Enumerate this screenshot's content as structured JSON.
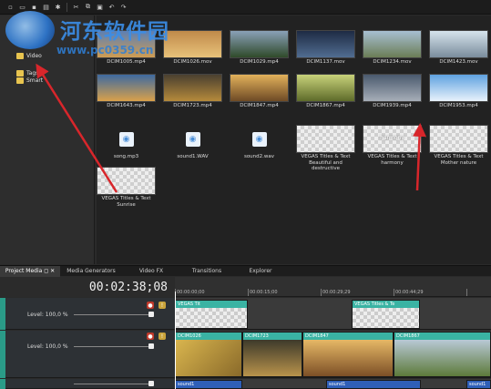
{
  "watermark": {
    "title": "河东软件园",
    "url": "www.pc0359.cn"
  },
  "tree": {
    "items": [
      "Video",
      "Tags",
      "Smart"
    ]
  },
  "media": [
    {
      "label": "DCIM1005.mp4",
      "type": "video",
      "c1": "#5b7fb5",
      "c2": "#cf9c52"
    },
    {
      "label": "DCIM1026.mov",
      "type": "video",
      "c1": "#c08a4a",
      "c2": "#e8c27a"
    },
    {
      "label": "DCIM1029.mp4",
      "type": "video",
      "c1": "#8aa0b8",
      "c2": "#2f4a2a"
    },
    {
      "label": "DCIM1137.mov",
      "type": "video",
      "c1": "#1e2b44",
      "c2": "#516d91"
    },
    {
      "label": "DCIM1234.mov",
      "type": "video",
      "c1": "#a7bfd2",
      "c2": "#6b7d56"
    },
    {
      "label": "DCIM1423.mov",
      "type": "video",
      "c1": "#d6e3ec",
      "c2": "#7a8c9c"
    },
    {
      "label": "DCIM1643.mp4",
      "type": "video",
      "c1": "#3e6aa0",
      "c2": "#d9a14a"
    },
    {
      "label": "DCIM1723.mp4",
      "type": "video",
      "c1": "#4a4030",
      "c2": "#b58a3b"
    },
    {
      "label": "DCIM1847.mp4",
      "type": "video",
      "c1": "#e2b15b",
      "c2": "#6e4a25"
    },
    {
      "label": "DCIM1867.mp4",
      "type": "video",
      "c1": "#c8d27a",
      "c2": "#5e6b2a"
    },
    {
      "label": "DCIM1939.mp4",
      "type": "video",
      "c1": "#4a5a6e",
      "c2": "#a7aeb8"
    },
    {
      "label": "DCIM1953.mp4",
      "type": "video",
      "c1": "#5fa2e0",
      "c2": "#e8f2fb"
    },
    {
      "label": "song.mp3",
      "type": "audio"
    },
    {
      "label": "sound1.WAV",
      "type": "audio"
    },
    {
      "label": "sound2.wav",
      "type": "audio"
    },
    {
      "label": "VEGAS Titles & Text Beautiful and destructive",
      "type": "title"
    },
    {
      "label": "VEGAS Titles & Text harmony",
      "type": "title",
      "overlay": "harmony"
    },
    {
      "label": "VEGAS Titles & Text Mother nature",
      "type": "title"
    },
    {
      "label": "VEGAS Titles & Text Sunrise",
      "type": "title"
    }
  ],
  "tabs": [
    "Project Media",
    "Media Generators",
    "Video FX",
    "Transitions",
    "Explorer"
  ],
  "timeline": {
    "timecode": "00:02:38;08",
    "ruler": [
      "00:00:00;00",
      "00:00:15;00",
      "00:00:29;29",
      "00:00:44;29"
    ],
    "track1": {
      "level": "Level: 100,0 %",
      "clips": [
        "VEGAS Tit",
        "VEGAS Titles & Te"
      ]
    },
    "track2": {
      "level": "Level: 100,0 %",
      "clips": [
        "DCIM1026",
        "DCIM1723",
        "DCIM1847",
        "DCIM1867"
      ]
    },
    "audio": [
      "sound1",
      "sound1",
      "sound1"
    ]
  },
  "colors": {
    "accent": "#3ab3a3",
    "arrow": "#d8262b",
    "audio": "#2f5fb8"
  }
}
